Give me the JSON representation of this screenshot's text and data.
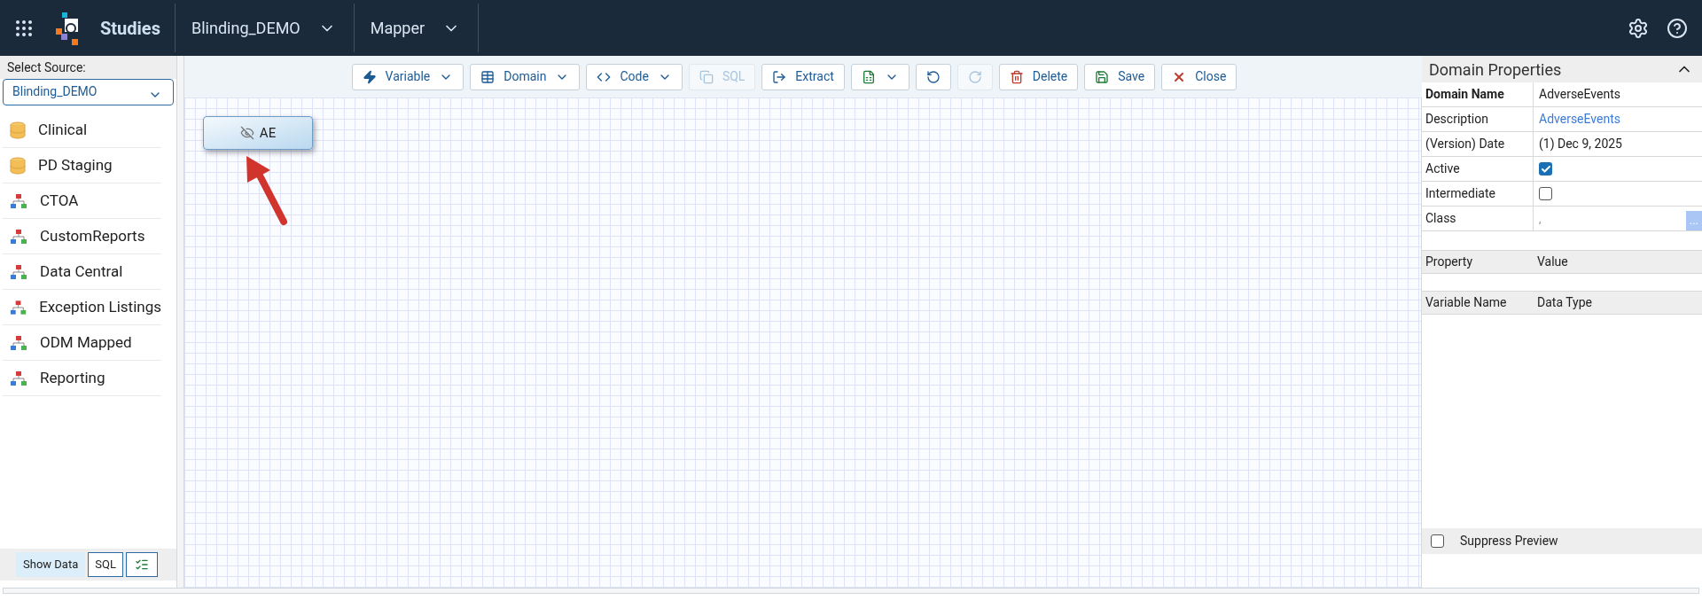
{
  "header": {
    "app_title": "Studies",
    "menus": [
      {
        "label": "Blinding_DEMO"
      },
      {
        "label": "Mapper"
      }
    ]
  },
  "source": {
    "label": "Select Source:",
    "value": "Blinding_DEMO",
    "items": [
      {
        "label": "Clinical",
        "kind": "database"
      },
      {
        "label": "PD Staging",
        "kind": "database"
      },
      {
        "label": "CTOA",
        "kind": "hierarchy"
      },
      {
        "label": "CustomReports",
        "kind": "hierarchy"
      },
      {
        "label": "Data Central",
        "kind": "hierarchy"
      },
      {
        "label": "Exception Listings",
        "kind": "hierarchy"
      },
      {
        "label": "ODM Mapped",
        "kind": "hierarchy"
      },
      {
        "label": "Reporting",
        "kind": "hierarchy"
      }
    ],
    "buttons": [
      {
        "label": "Show Data",
        "selected": true
      },
      {
        "label": "SQL",
        "selected": false
      }
    ]
  },
  "toolbar": [
    {
      "kind": "variable",
      "label": "Variable",
      "dropdown": true,
      "disabled": false
    },
    {
      "kind": "domain",
      "label": "Domain",
      "dropdown": true,
      "disabled": false
    },
    {
      "kind": "code",
      "label": "Code",
      "dropdown": true,
      "disabled": false
    },
    {
      "kind": "sql",
      "label": "SQL",
      "dropdown": false,
      "disabled": true
    },
    {
      "kind": "extract",
      "label": "Extract",
      "dropdown": false,
      "disabled": false
    },
    {
      "kind": "excel",
      "dropdown": true,
      "disabled": false
    },
    {
      "kind": "undo",
      "dropdown": false,
      "disabled": false
    },
    {
      "kind": "redo",
      "dropdown": false,
      "disabled": true
    },
    {
      "kind": "delete",
      "label": "Delete",
      "dropdown": false,
      "disabled": false
    },
    {
      "kind": "save",
      "label": "Save",
      "dropdown": false,
      "disabled": false
    },
    {
      "kind": "close",
      "label": "Close",
      "dropdown": false,
      "disabled": false
    }
  ],
  "canvas": {
    "nodes": [
      {
        "label": "AE"
      }
    ]
  },
  "properties": {
    "title": "Domain Properties",
    "rows": [
      {
        "kind": "text",
        "label": "Domain Name",
        "value": "AdverseEvents",
        "bold": true
      },
      {
        "kind": "link",
        "label": "Description",
        "value": "AdverseEvents",
        "bold": false
      },
      {
        "kind": "text",
        "label": "(Version) Date",
        "value": "(1) Dec 9, 2025",
        "bold": false
      },
      {
        "kind": "check",
        "label": "Active",
        "checked": true,
        "bold": false
      },
      {
        "kind": "check",
        "label": "Intermediate",
        "checked": false,
        "bold": false
      },
      {
        "kind": "picker",
        "label": "Class",
        "value": ",",
        "button": "...",
        "bold": false
      }
    ],
    "grid_columns": [
      "Property",
      "Value"
    ],
    "variable_columns": [
      "Variable Name",
      "Data Type"
    ],
    "suppress_preview": {
      "label": "Suppress Preview",
      "checked": false
    }
  }
}
